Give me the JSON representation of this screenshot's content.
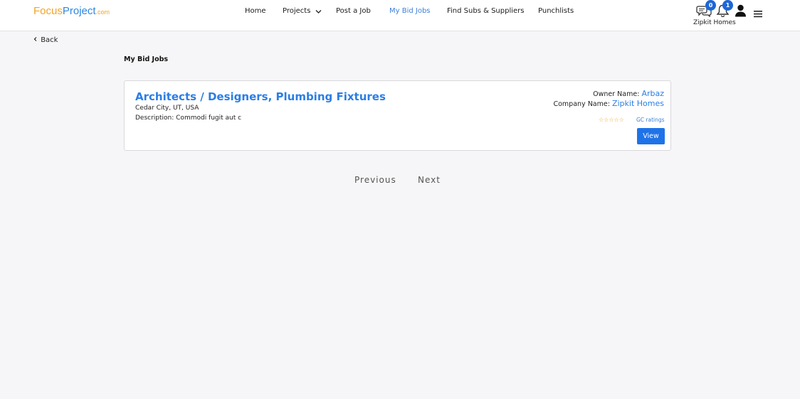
{
  "brand": {
    "part1": "Focus",
    "part2": "Project",
    "part3": ".com"
  },
  "nav": {
    "home": "Home",
    "projects": "Projects",
    "post_job": "Post a Job",
    "my_bid_jobs": "My Bid Jobs",
    "find_subs": "Find Subs & Suppliers",
    "punchlists": "Punchlists"
  },
  "header": {
    "messages_count": "0",
    "notifications_count": "1",
    "user_name": "Zipkit Homes",
    "icons": {
      "messages": "chat-bubbles-icon",
      "notifications": "bell-icon",
      "profile": "user-icon",
      "menu": "hamburger-menu-icon"
    }
  },
  "back_label": "Back",
  "page_title": "My Bid Jobs",
  "job": {
    "title": "Architects / Designers, Plumbing Fixtures",
    "location": "Cedar City, UT, USA",
    "description": "Description: Commodi fugit aut c",
    "owner_label": "Owner Name:",
    "owner_value": "Arbaz",
    "company_label": "Company Name:",
    "company_value": "Zipkit Homes",
    "rating_stars": "☆☆☆☆☆",
    "rating_label": "GC ratings",
    "view_label": "View"
  },
  "pagination": {
    "previous": "Previous",
    "next": "Next"
  },
  "colors": {
    "accent": "#2a7ee6",
    "brand_orange": "#f2a428",
    "button": "#1e73e8"
  }
}
